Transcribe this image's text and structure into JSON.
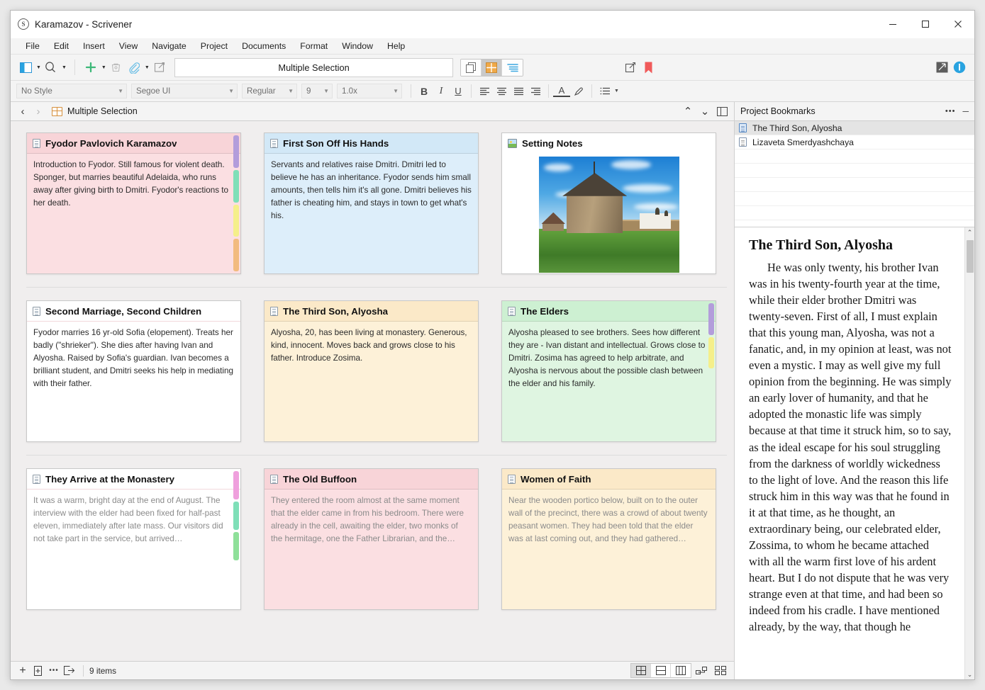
{
  "window": {
    "title": "Karamazov - Scrivener",
    "app_icon": "scrivener-s-icon",
    "minimize": "─",
    "maximize": "☐",
    "close": "✕"
  },
  "menubar": {
    "items": [
      "File",
      "Edit",
      "Insert",
      "View",
      "Navigate",
      "Project",
      "Documents",
      "Format",
      "Window",
      "Help"
    ]
  },
  "toolbar": {
    "document_title": "Multiple Selection",
    "buttons": [
      {
        "name": "toggle-binder",
        "label": ""
      },
      {
        "name": "search",
        "label": ""
      },
      {
        "name": "add-new",
        "label": ""
      },
      {
        "name": "trash",
        "label": ""
      },
      {
        "name": "attach-reference",
        "label": ""
      },
      {
        "name": "compose-mode",
        "label": ""
      }
    ],
    "view_modes": [
      {
        "name": "scrivenings",
        "active": false
      },
      {
        "name": "corkboard",
        "active": true
      },
      {
        "name": "outliner",
        "active": false
      }
    ],
    "right_buttons": [
      {
        "name": "quick-reference",
        "label": ""
      },
      {
        "name": "bookmark",
        "label": ""
      },
      {
        "name": "composition-mode",
        "label": ""
      },
      {
        "name": "inspector",
        "label": ""
      }
    ]
  },
  "formatbar": {
    "style": "No Style",
    "font": "Segoe UI",
    "weight": "Regular",
    "size": "9",
    "line_spacing": "1.0x",
    "bold": "B",
    "italic": "I",
    "underline": "U",
    "align_left": "align-left",
    "align_center": "align-center",
    "align_justify": "align-justify",
    "align_right": "align-right",
    "font_color": "A",
    "highlight": "highlight",
    "list": "list"
  },
  "header": {
    "back": "‹",
    "forward": "›",
    "breadcrumb": "Multiple Selection",
    "go_up": "⌃",
    "go_down": "⌄",
    "split": "split-editor"
  },
  "corkboard": {
    "rows": [
      {
        "divided": true,
        "cards": [
          {
            "title": "Fyodor Pavlovich  Karamazov",
            "icon": "document-icon",
            "synopsis": "Introduction to Fyodor. Still famous for violent death. Sponger, but marries beautiful Adelaida, who runs away after giving birth to Dmitri. Fyodor's reactions to her death.",
            "bg": "#fbdfe2",
            "head_bg": "#f8d4d8",
            "muted": false,
            "tabs": [
              "#b39ddb",
              "#7fdfb8",
              "#f5ef8a",
              "#f2bb7f"
            ]
          },
          {
            "title": "First Son Off His Hands",
            "icon": "document-icon",
            "synopsis": "Servants and relatives raise Dmitri. Dmitri led to believe he has an inheritance. Fyodor sends him small amounts, then tells him it's all gone. Dmitri believes his father is cheating him, and stays in town to get what's his.",
            "bg": "#ddeefa",
            "head_bg": "#d2e8f7",
            "muted": false,
            "tabs": []
          },
          {
            "title": "Setting Notes",
            "icon": "image-icon",
            "synopsis": "",
            "image": "monastery-photo",
            "bg": "#ffffff",
            "head_bg": "#ffffff",
            "muted": false,
            "tabs": []
          }
        ]
      },
      {
        "divided": true,
        "cards": [
          {
            "title": "Second Marriage, Second Children",
            "icon": "document-icon",
            "synopsis": "Fyodor marries 16 yr-old Sofia (elopement). Treats her badly (\"shrieker\"). She dies after having Ivan and Alyosha. Raised by Sofia's guardian. Ivan becomes a brilliant student, and Dmitri seeks his help in mediating with their father.",
            "bg": "#ffffff",
            "head_bg": "#ffffff",
            "muted": false,
            "tabs": []
          },
          {
            "title": "The Third Son, Alyosha",
            "icon": "document-icon",
            "synopsis": "Alyosha, 20, has been living at monastery. Generous, kind, innocent. Moves back and grows close to his father. Introduce Zosima.",
            "bg": "#fdf1d8",
            "head_bg": "#fbe9c8",
            "muted": false,
            "tabs": []
          },
          {
            "title": "The Elders",
            "icon": "document-icon",
            "synopsis": "Alyosha pleased to see brothers. Sees how different they are - Ivan distant and intellectual. Grows close to Dmitri. Zosima has agreed to help arbitrate, and Alyosha is nervous about the possible clash between the elder and his family.",
            "bg": "#dff5e1",
            "head_bg": "#cdf0d2",
            "muted": false,
            "tabs": [
              "#b39ddb",
              "#f5ef8a"
            ]
          }
        ]
      },
      {
        "divided": false,
        "cards": [
          {
            "title": "They Arrive at the Monastery",
            "icon": "document-icon",
            "synopsis": "It was a warm, bright day at the end of August. The interview with the elder had been fixed for half-past eleven, immediately after late mass. Our visitors did not take part in the service, but arrived…",
            "bg": "#ffffff",
            "head_bg": "#ffffff",
            "muted": true,
            "tabs": [
              "#efa0dd",
              "#7fdfb8",
              "#8fe09a"
            ]
          },
          {
            "title": "The Old Buffoon",
            "icon": "document-icon",
            "synopsis": "They entered the room almost at the same moment that the elder came in from his bedroom. There were already in the cell, awaiting the elder, two monks of the hermitage, one the Father Librarian, and the…",
            "bg": "#fbdfe2",
            "head_bg": "#f8d4d8",
            "muted": true,
            "tabs": []
          },
          {
            "title": "Women of Faith",
            "icon": "document-icon",
            "synopsis": "Near the wooden portico below, built on to the outer wall of the precinct, there was a crowd of about twenty peasant women. They had been told that the elder was at last coming out, and they had gathered…",
            "bg": "#fdf1d8",
            "head_bg": "#fbe9c8",
            "muted": true,
            "tabs": []
          }
        ]
      }
    ]
  },
  "footer": {
    "add": "+",
    "add_folder": "add-folder",
    "more": "•••",
    "move_to": "move-to",
    "item_count": "9 items",
    "view_buttons": [
      "corkboard-grid",
      "corkboard-rows",
      "corkboard-columns",
      "freeform",
      "labels"
    ]
  },
  "inspector": {
    "panel_title": "Project Bookmarks",
    "options": "•••",
    "minimize": "─",
    "bookmarks": [
      {
        "label": "The Third Son, Alyosha",
        "selected": true,
        "icon": "document-blue-icon"
      },
      {
        "label": "Lizaveta Smerdyashchaya",
        "selected": false,
        "icon": "document-gray-icon"
      }
    ],
    "preview": {
      "doc_title": "The Third Son, Alyosha",
      "text": "He was only twenty, his brother Ivan was in his twenty-fourth year at the time, while their elder brother Dmitri was twenty-seven. First of all, I must explain that this young man, Alyosha, was not a fanatic, and, in my opinion at least, was not even a mystic. I may as well give my full opinion from the beginning. He was simply an early lover of humanity, and that he adopted the monastic life was simply because at that time it struck him, so to say, as the ideal escape for his soul struggling from the darkness of worldly wickedness to the light of love. And the reason this life struck him in this way was that he found in it at that time, as he thought, an extraordinary being, our celebrated elder, Zossima, to whom he became attached with all the warm first love of his ardent heart. But I do not dispute that he was very strange even at that time, and had been so indeed from his cradle. I have mentioned already, by the way, that though he"
    },
    "scroll_up": "⌃",
    "scroll_down": "⌄"
  },
  "colors": {
    "accent_orange": "#e8a33d",
    "accent_blue": "#29a3e0",
    "bookmark_red": "#f05a5a",
    "add_green": "#3cb878"
  }
}
